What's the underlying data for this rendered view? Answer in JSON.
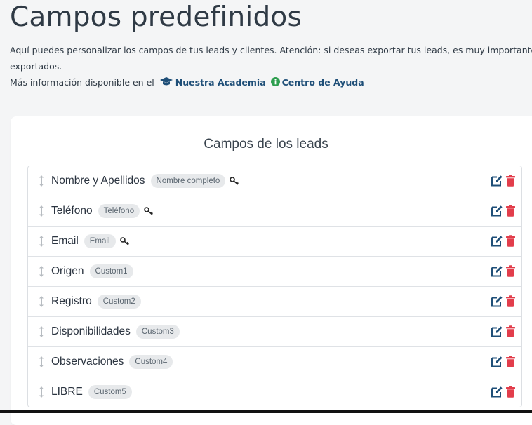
{
  "header": {
    "title": "Campos predefinidos",
    "intro_line1": "Aquí puedes personalizar los campos de tus leads y clientes. Atención: si deseas exportar tus leads, es muy importante que",
    "intro_line2": "exportados.",
    "more_info_prefix": "Más información disponible en el",
    "academy_link": "Nuestra Academia",
    "help_link": "Centro de Ayuda"
  },
  "card": {
    "title": "Campos de los leads"
  },
  "fields": [
    {
      "name": "Nombre y Apellidos",
      "tag": "Nombre completo",
      "key": true
    },
    {
      "name": "Teléfono",
      "tag": "Teléfono",
      "key": true
    },
    {
      "name": "Email",
      "tag": "Email",
      "key": true
    },
    {
      "name": "Origen",
      "tag": "Custom1",
      "key": false
    },
    {
      "name": "Registro",
      "tag": "Custom2",
      "key": false
    },
    {
      "name": "Disponibilidades",
      "tag": "Custom3",
      "key": false
    },
    {
      "name": "Observaciones",
      "tag": "Custom4",
      "key": false
    },
    {
      "name": "LIBRE",
      "tag": "Custom5",
      "key": false
    }
  ],
  "icons": {
    "drag": "drag-handle-icon",
    "key": "key-icon",
    "edit": "edit-icon",
    "delete": "trash-icon",
    "academy": "graduation-cap-icon",
    "help": "info-circle-icon"
  },
  "colors": {
    "link": "#1f4f78",
    "edit": "#1f4f78",
    "delete": "#e23d4b",
    "help_icon": "#2e9e4f",
    "badge_bg": "#e7e9eb"
  }
}
